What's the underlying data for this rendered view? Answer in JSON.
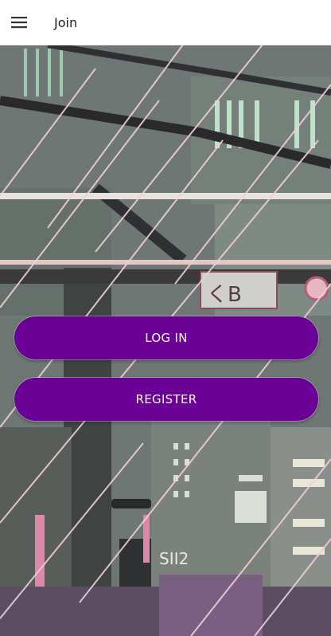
{
  "appbar": {
    "title": "Join",
    "menu_icon": "hamburger-menu-icon"
  },
  "actions": {
    "login_label": "LOG IN",
    "register_label": "REGISTER"
  },
  "background": {
    "sign_text_1": "くB",
    "sign_text_2": "SII2",
    "colors": {
      "button": "#6a0096",
      "rain": "#e7c8cf",
      "city": "#5f6662"
    }
  }
}
